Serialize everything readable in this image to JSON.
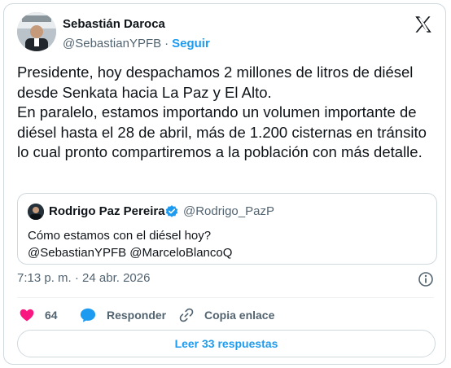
{
  "author": {
    "name": "Sebastián Daroca",
    "handle": "@SebastianYPFB",
    "separator": "·",
    "follow_label": "Seguir"
  },
  "tweet": {
    "text": "Presidente, hoy despachamos 2 millones de litros de diésel desde Senkata hacia La Paz y El Alto.\nEn paralelo, estamos importando un volumen importante de diésel hasta el 28 de abril, más de 1.200 cisternas en tránsito lo cual pronto compartiremos a la población con más detalle.",
    "timestamp": "7:13 p. m. · 24 abr. 2026"
  },
  "quoted": {
    "name": "Rodrigo Paz Pereira",
    "handle": "@Rodrigo_PazP",
    "text": "Cómo estamos con el diésel hoy?\n@SebastianYPFB @MarceloBlancoQ"
  },
  "actions": {
    "likes": "64",
    "reply_label": "Responder",
    "copy_label": "Copia enlace"
  },
  "replies_button": "Leer 33 respuestas",
  "colors": {
    "accent": "#1d9bf0",
    "like": "#f91880",
    "text": "#0f1419",
    "muted": "#536471",
    "border": "#cfd9de"
  },
  "icons": [
    "x-logo-icon",
    "verified-badge-icon",
    "info-icon",
    "heart-icon",
    "reply-bubble-icon",
    "link-icon"
  ]
}
